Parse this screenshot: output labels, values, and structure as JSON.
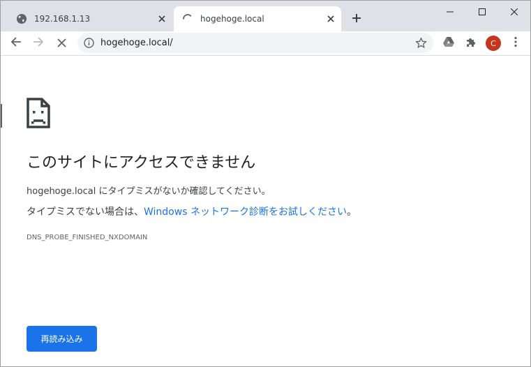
{
  "tabs": [
    {
      "title": "192.168.1.13",
      "icon": "globe-icon",
      "active": false
    },
    {
      "title": "hogehoge.local",
      "icon": "loading-spinner-icon",
      "active": true
    }
  ],
  "toolbar": {
    "url": "hogehoge.local/",
    "avatar_letter": "C",
    "avatar_color": "#c5341c"
  },
  "error_page": {
    "title": "このサイトにアクセスできません",
    "line1": "hogehoge.local にタイプミスがないか確認してください。",
    "line2_prefix": "タイプミスでない場合は、",
    "line2_link": "Windows ネットワーク診断をお試しください",
    "line2_suffix": "。",
    "error_code": "DNS_PROBE_FINISHED_NXDOMAIN",
    "reload_label": "再読み込み"
  },
  "colors": {
    "accent": "#1a73e8",
    "tabstrip_bg": "#dee1e6",
    "omnibox_bg": "#f1f3f4"
  }
}
